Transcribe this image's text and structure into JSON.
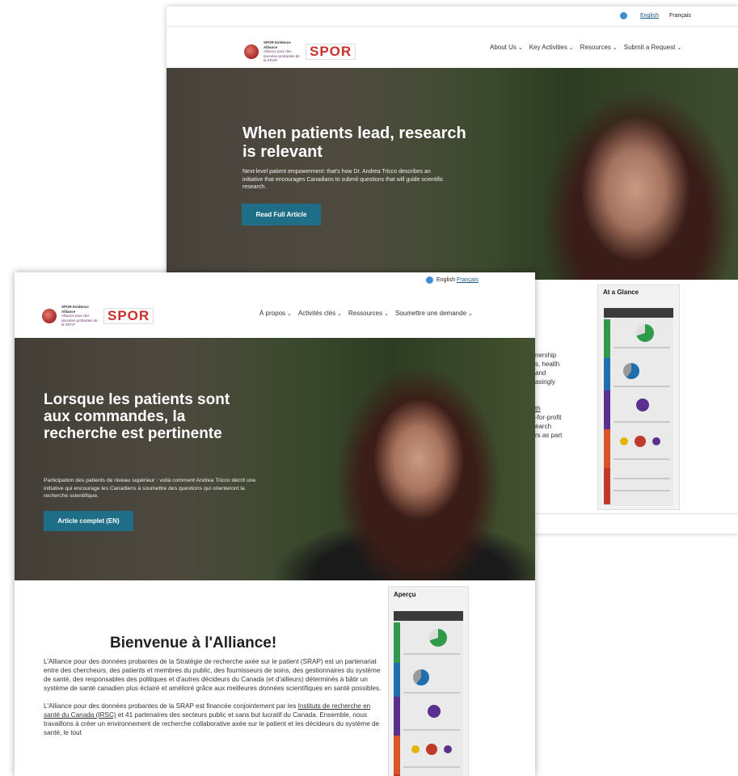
{
  "back_window": {
    "lang": {
      "en": "English",
      "fr": "Français"
    },
    "logo": {
      "text_line1": "SPOR Evidence Alliance",
      "text_line2": "Alliance pour des données probantes de la SRAP",
      "wordmark": "SPOR"
    },
    "nav": [
      "About Us",
      "Key Activities",
      "Resources",
      "Submit a Request"
    ],
    "hero": {
      "title": "When patients lead, research is relevant",
      "text": "Next-level patient empowerment: that's how Dr. Andrea Tricco describes an initiative that encourages Canadians to submit questions that will guide scientific research.",
      "button": "Read Full Article"
    },
    "glance_title": "At a Glance",
    "peek_lines": [
      "nership",
      "s, health",
      "and",
      "asingly",
      "",
      "",
      "th",
      "-for-profit",
      "earch",
      "rs as part"
    ]
  },
  "front_window": {
    "lang": {
      "en": "English",
      "fr": "Français"
    },
    "logo": {
      "text_line1": "SPOR Evidence Alliance",
      "text_line2": "Alliance pour des données probantes de la SRAP",
      "wordmark": "SPOR"
    },
    "nav": [
      "À propos",
      "Activités clés",
      "Ressources",
      "Soumettre une demande"
    ],
    "hero": {
      "title": "Lorsque les patients sont aux commandes, la recherche est pertinente",
      "text": "Participation des patients de niveau supérieur : voilà comment Andrea Tricco décrit une initiative qui encourage les Canadiens à soumettre des questions qui orienteront la recherche scientifique.",
      "button": "Article complet (EN)"
    },
    "welcome": "Bienvenue à l'Alliance!",
    "para1": "L'Alliance pour des données probantes de la Stratégie de recherche axée sur le patient (SRAP) est un partenariat entre des chercheurs, des patients et membres du public, des fournisseurs de soins, des gestionnaires du système de santé, des responsables des politiques et d'autres décideurs du Canada (et d'ailleurs) déterminés à bâtir un système de santé canadien plus éclairé et amélioré grâce aux meilleures données scientifiques en santé possibles.",
    "para2_before": "L'Alliance pour des données probantes de la SRAP est financée conjointement par les ",
    "para2_link": "Instituts de recherche en santé du Canada (IRSC)",
    "para2_after": " et 41 partenaires des secteurs public et sans but lucratif du Canada. Ensemble, nous travaillons à créer un environnement de recherche collaborative axée sur le patient et les décideurs du système de santé, le tout",
    "apercu_title": "Aperçu"
  },
  "colors": {
    "accent_button": "#1e6e88",
    "link": "#1b5a86",
    "spor_red": "#c9302c"
  }
}
